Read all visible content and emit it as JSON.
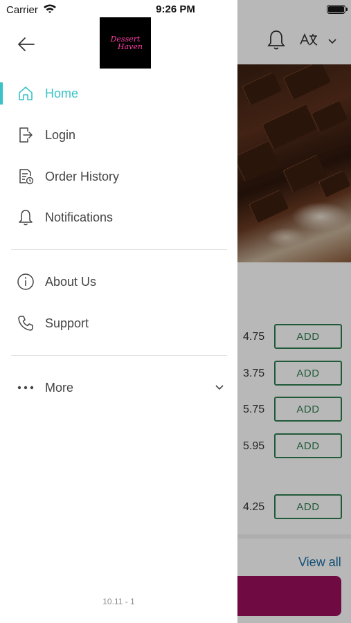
{
  "status_bar": {
    "carrier": "Carrier",
    "time": "9:26 PM"
  },
  "brand": {
    "logo_line1": "Dessert",
    "logo_line2": "Haven",
    "logo_color": "#ff3ea5"
  },
  "drawer": {
    "accent_color": "#39c3c6",
    "primary_items": [
      {
        "label": "Home",
        "icon": "home-icon",
        "active": true
      },
      {
        "label": "Login",
        "icon": "login-icon",
        "active": false
      },
      {
        "label": "Order History",
        "icon": "order-history-icon",
        "active": false
      },
      {
        "label": "Notifications",
        "icon": "bell-icon",
        "active": false
      }
    ],
    "secondary_items": [
      {
        "label": "About Us",
        "icon": "info-icon"
      },
      {
        "label": "Support",
        "icon": "phone-icon"
      }
    ],
    "more": {
      "label": "More",
      "icon": "more-dots-icon"
    },
    "version": "10.11 - 1"
  },
  "background": {
    "prices": [
      "4.75",
      "3.75",
      "5.75",
      "5.95",
      "4.25"
    ],
    "add_label": "ADD",
    "view_all": "View all",
    "cta_color": "#9a0f5d"
  }
}
